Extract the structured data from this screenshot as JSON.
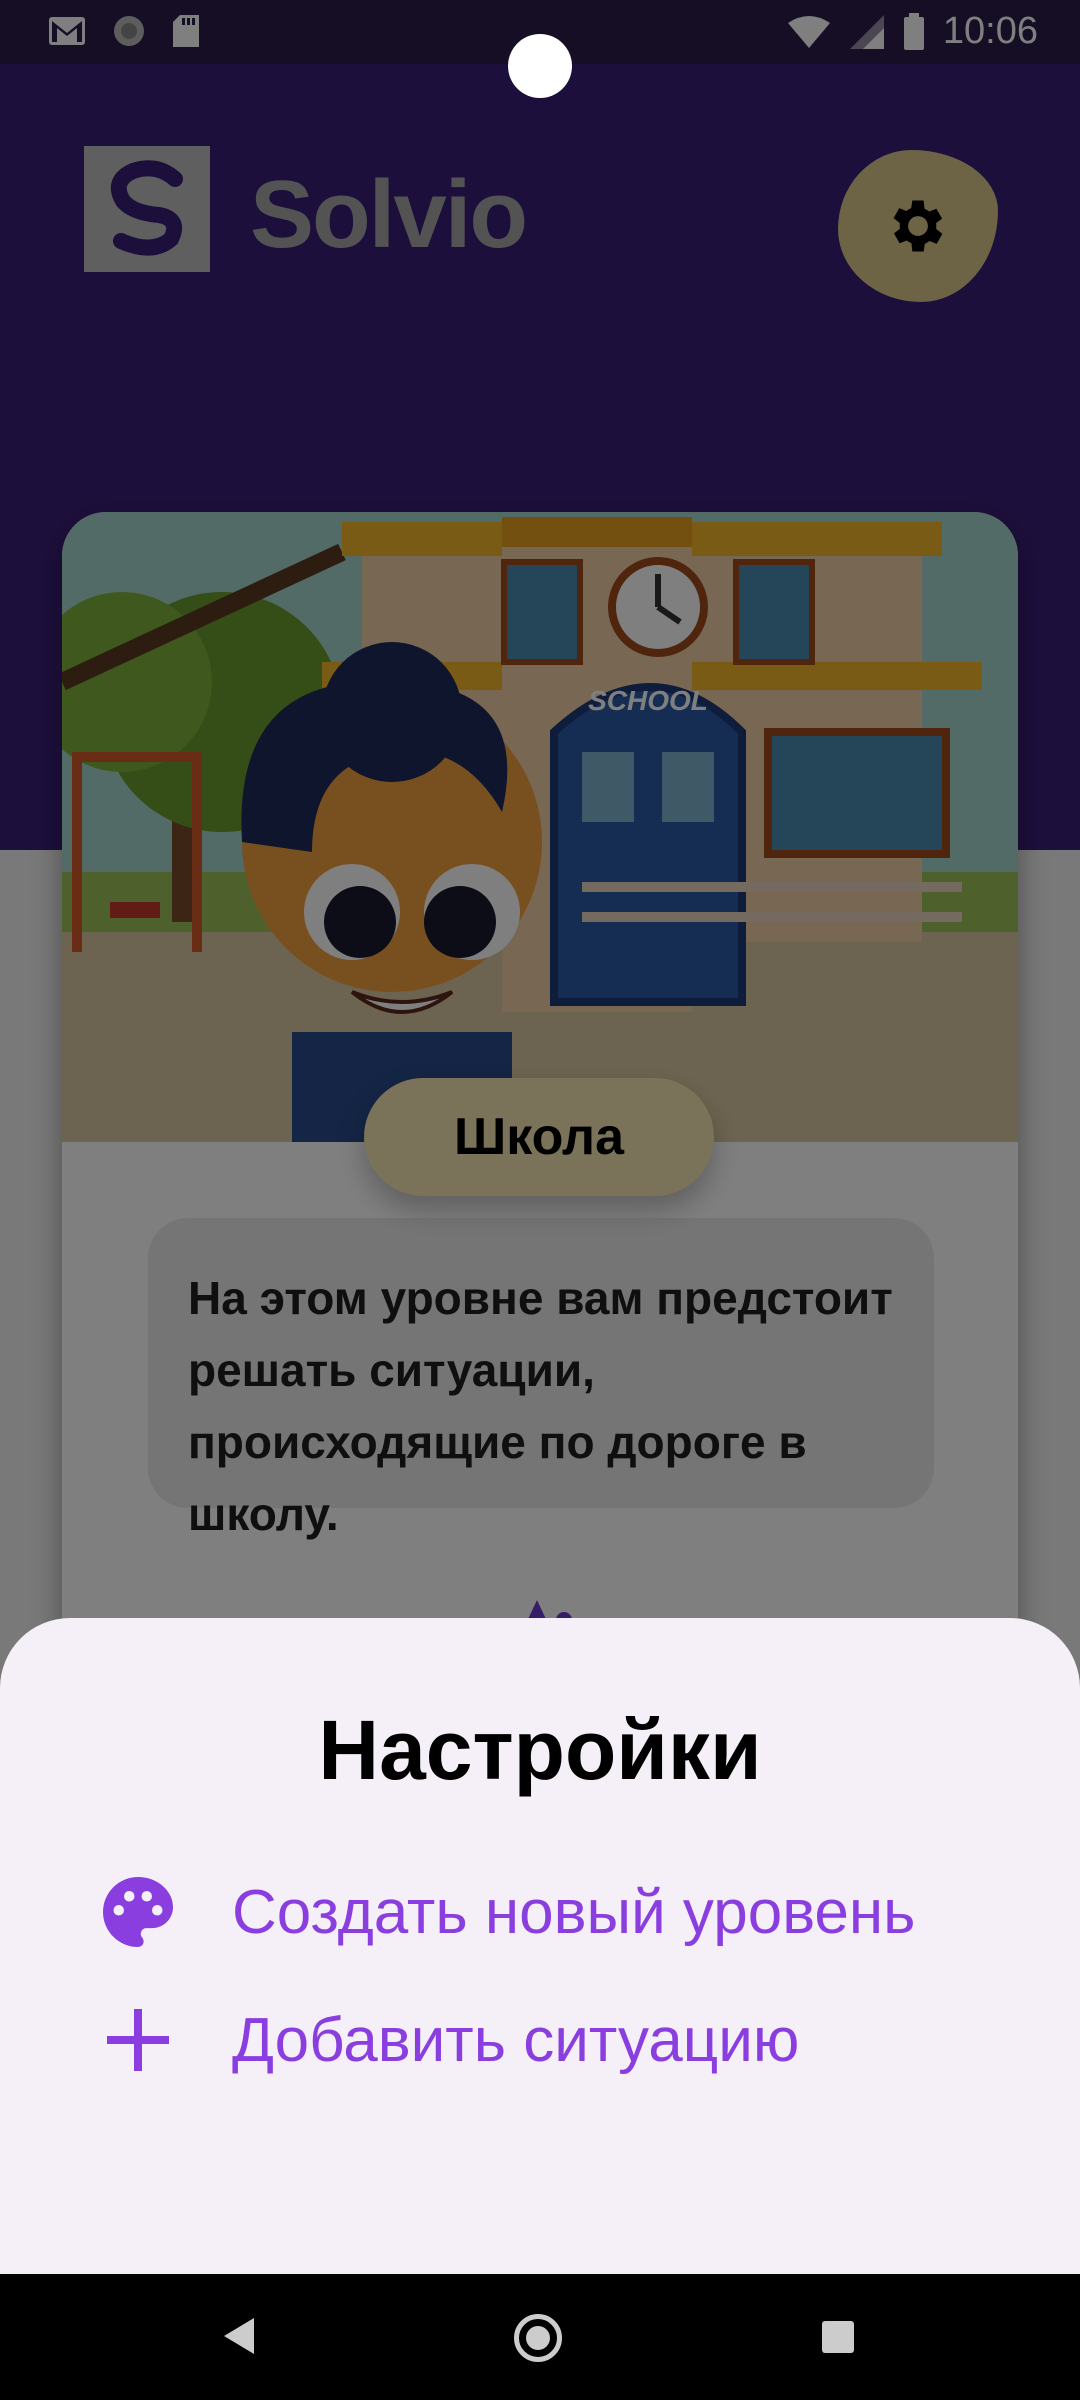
{
  "status_bar": {
    "time": "10:06"
  },
  "app": {
    "name": "Solvio",
    "logo_letter": "S"
  },
  "level": {
    "name": "Школа",
    "description": "На этом уровне вам предстоит решать ситуации, происходящие по дороге в школу.",
    "school_sign": "SCHOOL"
  },
  "settings_sheet": {
    "title": "Настройки",
    "items": [
      {
        "label": "Создать новый уровень",
        "icon": "palette-icon"
      },
      {
        "label": "Добавить ситуацию",
        "icon": "plus-icon"
      }
    ]
  },
  "colors": {
    "header": "#3b1f78",
    "accent": "#8a3ee0",
    "settings_blob": "#d8c98a",
    "pill": "#f5e7b5"
  }
}
